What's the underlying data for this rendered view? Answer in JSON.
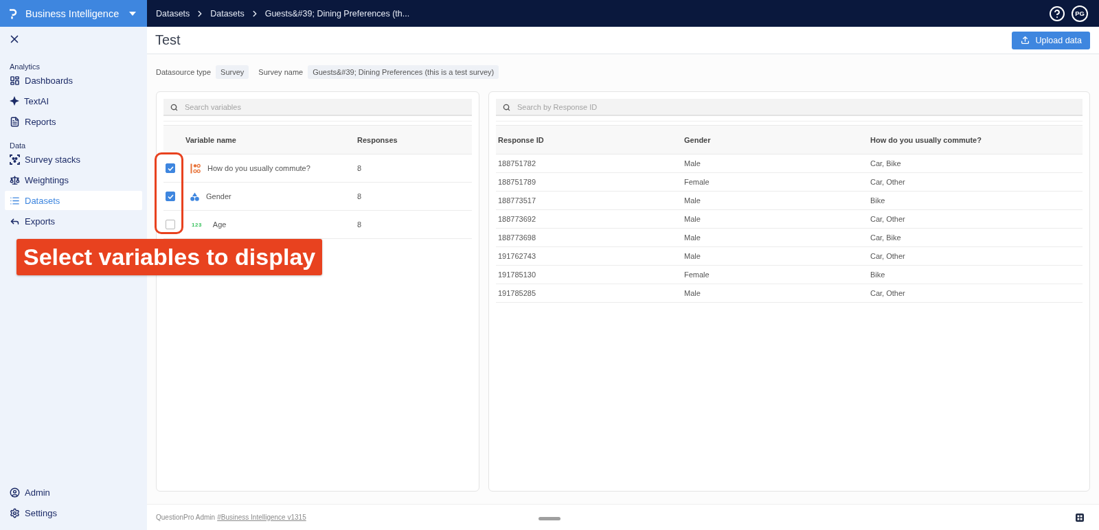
{
  "brand": {
    "name": "Business Intelligence"
  },
  "breadcrumbs": [
    {
      "label": "Datasets"
    },
    {
      "label": "Datasets"
    },
    {
      "label": "Guests&#39; Dining Preferences (th..."
    }
  ],
  "user": {
    "initials": "PG"
  },
  "sidebar": {
    "sections": [
      {
        "title": "Analytics",
        "items": [
          {
            "label": "Dashboards",
            "selected": false
          },
          {
            "label": "TextAI",
            "selected": false
          },
          {
            "label": "Reports",
            "selected": false
          }
        ]
      },
      {
        "title": "Data",
        "items": [
          {
            "label": "Survey stacks",
            "selected": false
          },
          {
            "label": "Weightings",
            "selected": false
          },
          {
            "label": "Datasets",
            "selected": true
          },
          {
            "label": "Exports",
            "selected": false
          }
        ]
      }
    ],
    "bottom_items": [
      {
        "label": "Admin",
        "selected": false
      },
      {
        "label": "Settings",
        "selected": false
      }
    ]
  },
  "page": {
    "title": "Test",
    "upload_button": "Upload data"
  },
  "meta": [
    {
      "label": "Datasource type",
      "value": "Survey"
    },
    {
      "label": "Survey name",
      "value": "Guests&#39; Dining Preferences (this is a test survey)"
    }
  ],
  "variables_panel": {
    "search": {
      "placeholder": "Search variables"
    },
    "columns": [
      "Variable name",
      "Responses"
    ],
    "rows": [
      {
        "kind": "multiple_choice",
        "name": "How do you usually commute?",
        "responses": "8",
        "checked": true
      },
      {
        "kind": "single_choice",
        "name": "Gender",
        "responses": "8",
        "checked": true
      },
      {
        "kind": "numeric",
        "type_text": "123",
        "name": "Age",
        "responses": "8",
        "checked": false
      }
    ]
  },
  "responses_panel": {
    "search": {
      "placeholder": "Search by Response ID"
    },
    "columns": [
      "Response ID",
      "Gender",
      "How do you usually commute?"
    ],
    "rows": [
      [
        "188751782",
        "Male",
        "Car, Bike"
      ],
      [
        "188751789",
        "Female",
        "Car, Other"
      ],
      [
        "188773517",
        "Male",
        "Bike"
      ],
      [
        "188773692",
        "Male",
        "Car, Other"
      ],
      [
        "188773698",
        "Male",
        "Car, Bike"
      ],
      [
        "191762743",
        "Male",
        "Car, Other"
      ],
      [
        "191785130",
        "Female",
        "Bike"
      ],
      [
        "191785285",
        "Male",
        "Car, Other"
      ]
    ]
  },
  "footer": {
    "text": "QuestionPro Admin",
    "link": "#Business Intelligence v1315"
  },
  "annotation": {
    "text": "Select variables to display"
  }
}
